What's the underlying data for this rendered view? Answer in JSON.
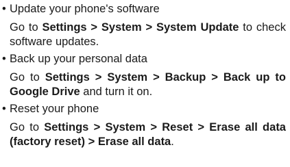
{
  "bullet_symbol": "•",
  "items": [
    {
      "title": "Update your phone's software",
      "detail": {
        "prefix": "Go to ",
        "path": "Settings > System > System Update",
        "suffix": " to check software updates."
      }
    },
    {
      "title": "Back up your personal data",
      "detail": {
        "prefix": "Go to ",
        "path": "Settings > System > Backup > Back up to Google Drive",
        "suffix": " and turn it on."
      }
    },
    {
      "title": "Reset your phone",
      "detail": {
        "prefix": "Go to ",
        "path": "Settings > System > Reset > Erase all data (factory reset) > Erase all data",
        "suffix": "."
      }
    }
  ]
}
